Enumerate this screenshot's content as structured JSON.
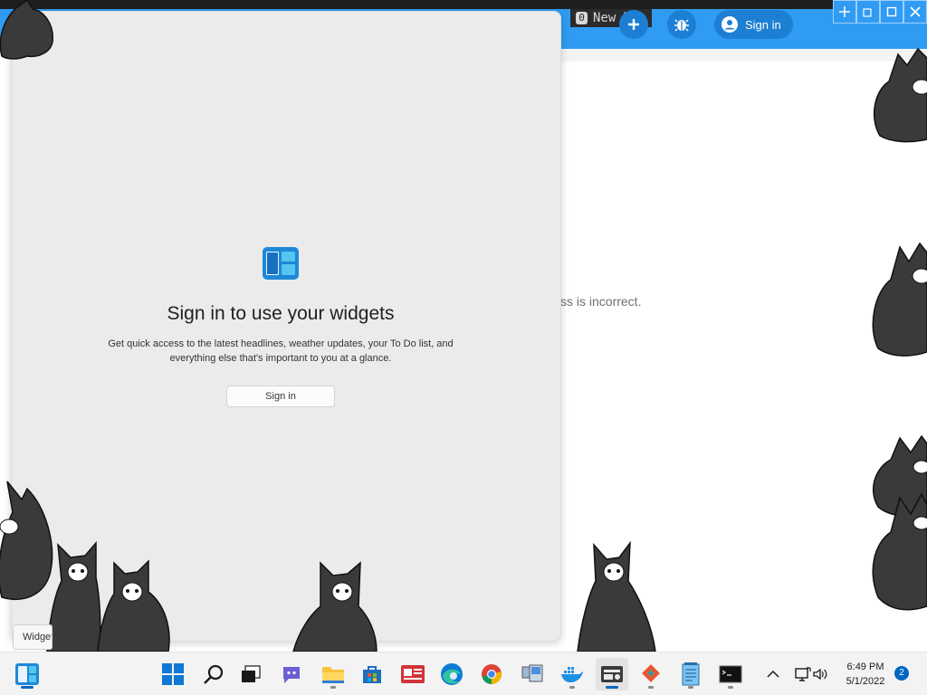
{
  "browser": {
    "tab_count": "0",
    "tab_title": "New Tab",
    "signin_label": "Sign in",
    "partial_error_text": "ss is incorrect."
  },
  "widgets": {
    "title": "Sign in to use your widgets",
    "description": "Get quick access to the latest headlines, weather updates, your To Do list, and everything else that's important to you at a glance.",
    "signin_label": "Sign in"
  },
  "tooltip": {
    "text": "Widgets"
  },
  "taskbar": {
    "apps": [
      {
        "name": "widgets",
        "icon": "widgets-icon"
      },
      {
        "name": "start",
        "icon": "windows-start-icon"
      },
      {
        "name": "search",
        "icon": "search-icon"
      },
      {
        "name": "task-view",
        "icon": "task-view-icon"
      },
      {
        "name": "chat",
        "icon": "teams-chat-icon"
      },
      {
        "name": "file-explorer",
        "icon": "folder-icon"
      },
      {
        "name": "store",
        "icon": "store-icon"
      },
      {
        "name": "news",
        "icon": "news-icon"
      },
      {
        "name": "edge",
        "icon": "edge-icon"
      },
      {
        "name": "chrome",
        "icon": "chrome-icon"
      },
      {
        "name": "remote",
        "icon": "remote-desktop-icon"
      },
      {
        "name": "docker",
        "icon": "docker-icon"
      },
      {
        "name": "card-app",
        "icon": "card-app-icon"
      },
      {
        "name": "git",
        "icon": "git-icon"
      },
      {
        "name": "notepad",
        "icon": "notepad-icon"
      },
      {
        "name": "terminal",
        "icon": "terminal-icon"
      }
    ],
    "time": "6:49 PM",
    "date": "5/1/2022",
    "notification_count": "2"
  },
  "colors": {
    "browser_accent": "#2f9bf3",
    "widget_panel_bg": "#ebebeb",
    "taskbar_bg": "#f3f3f3",
    "windows_blue": "#0067c0"
  }
}
